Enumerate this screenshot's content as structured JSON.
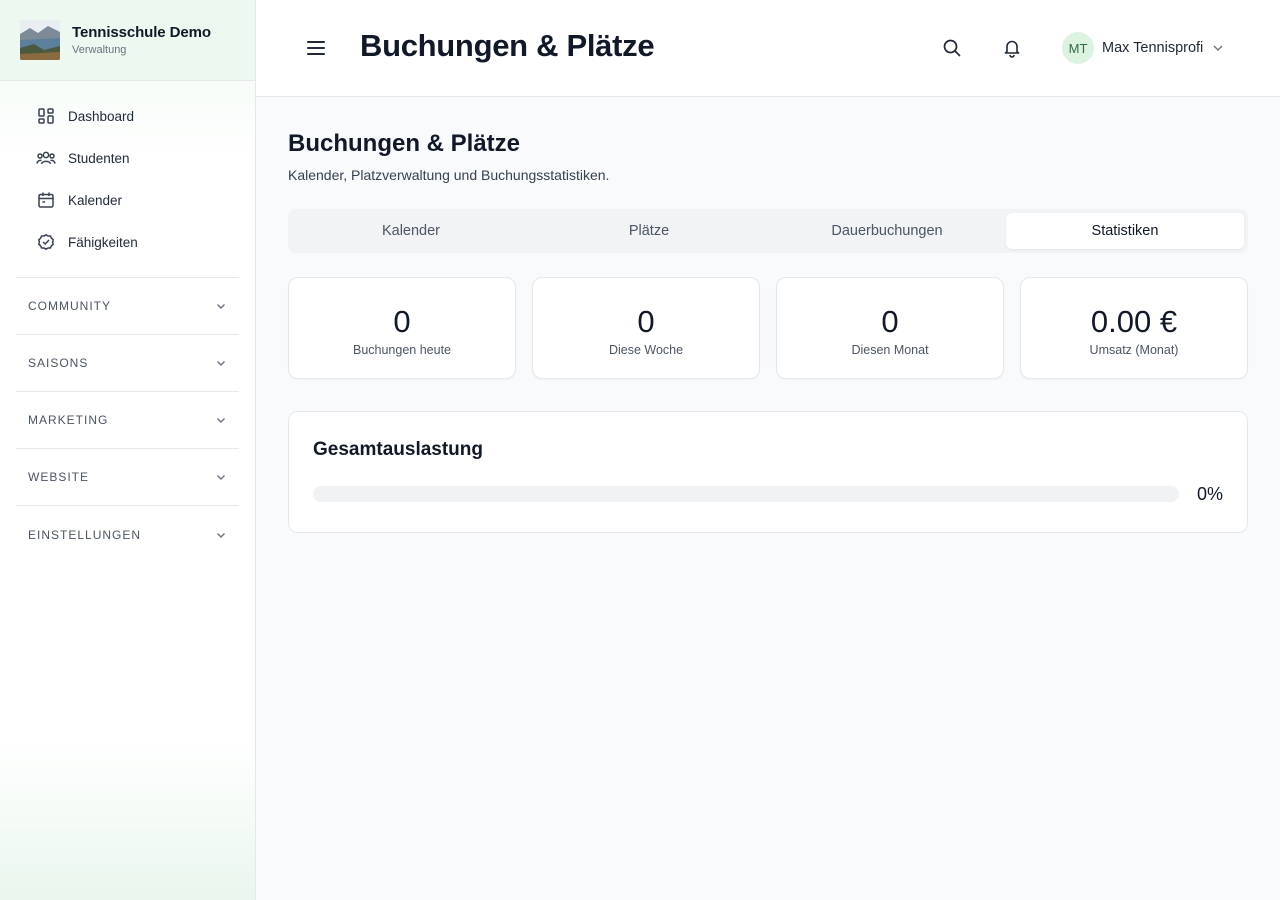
{
  "brand": {
    "name": "Tennisschule Demo",
    "subtitle": "Verwaltung"
  },
  "nav": [
    {
      "label": "Dashboard",
      "icon": "dashboard-icon"
    },
    {
      "label": "Studenten",
      "icon": "users-icon"
    },
    {
      "label": "Kalender",
      "icon": "calendar-icon"
    },
    {
      "label": "Fähigkeiten",
      "icon": "check-circle-icon"
    }
  ],
  "sections": [
    "COMMUNITY",
    "SAISONS",
    "MARKETING",
    "WEBSITE",
    "EINSTELLUNGEN"
  ],
  "header": {
    "title": "Buchungen & Plätze",
    "user_initials": "MT",
    "user_name": "Max Tennisprofi"
  },
  "page": {
    "title": "Buchungen & Plätze",
    "subtitle": "Kalender, Platzverwaltung und Buchungsstatistiken."
  },
  "tabs": [
    {
      "label": "Kalender",
      "active": false
    },
    {
      "label": "Plätze",
      "active": false
    },
    {
      "label": "Dauerbuchungen",
      "active": false
    },
    {
      "label": "Statistiken",
      "active": true
    }
  ],
  "stats": [
    {
      "value": "0",
      "label": "Buchungen heute"
    },
    {
      "value": "0",
      "label": "Diese Woche"
    },
    {
      "value": "0",
      "label": "Diesen Monat"
    },
    {
      "value": "0.00 €",
      "label": "Umsatz (Monat)"
    }
  ],
  "utilization": {
    "title": "Gesamtauslastung",
    "percent_label": "0%",
    "percent": 0
  },
  "colors": {
    "accent": "#22c55e",
    "avatar_bg": "#dcf3e2",
    "sidebar_tint": "#edf8f0"
  }
}
